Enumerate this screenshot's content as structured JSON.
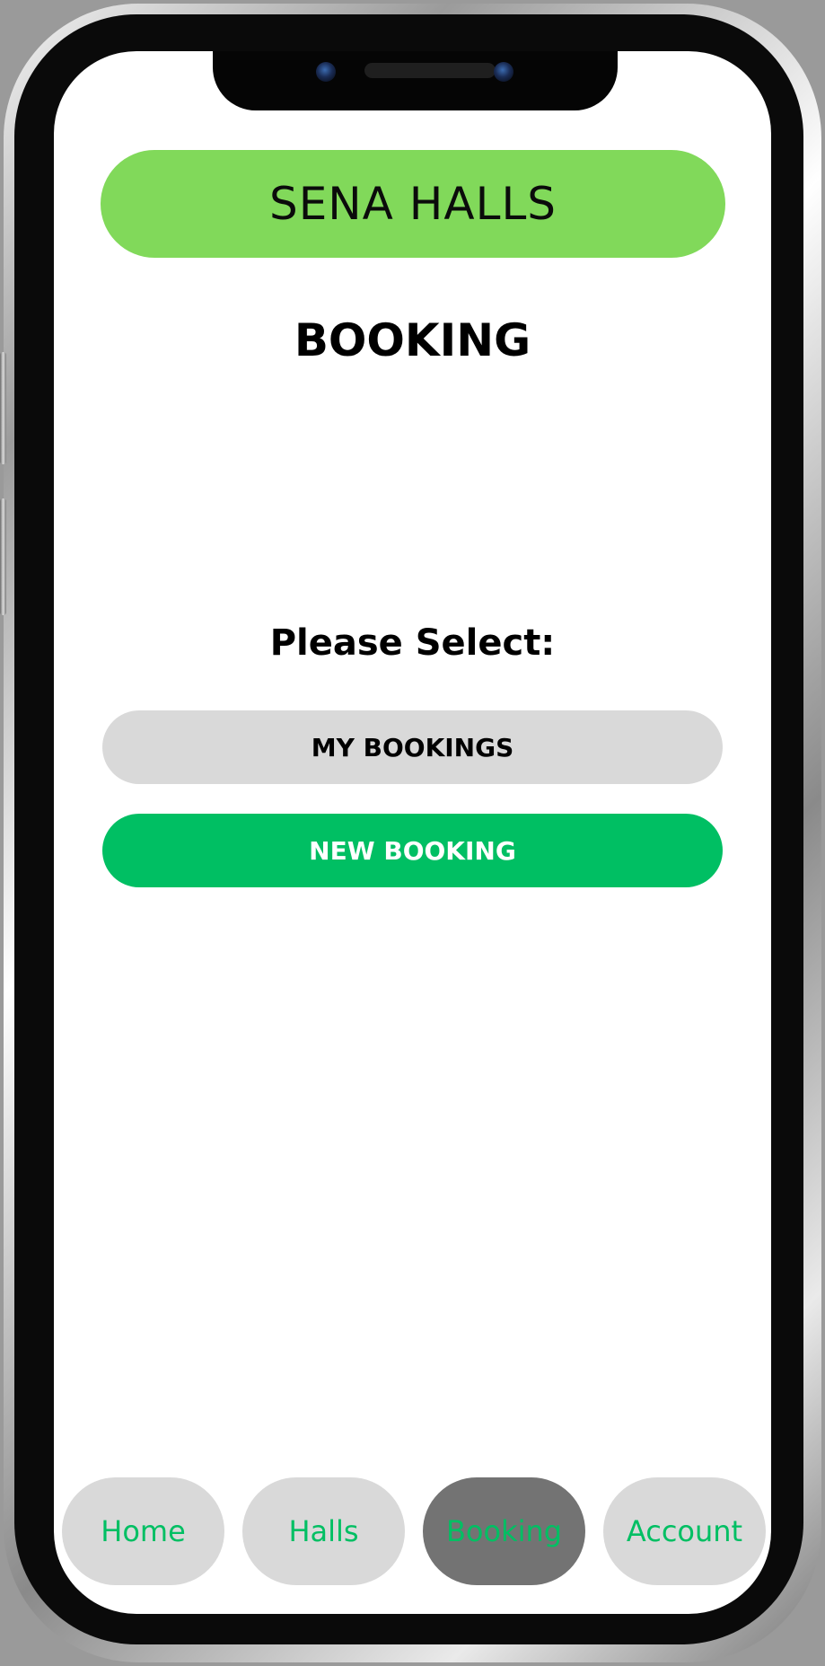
{
  "app": {
    "brand": "SENA HALLS",
    "page_title": "BOOKING"
  },
  "main": {
    "prompt": "Please Select:",
    "my_bookings_label": "MY BOOKINGS",
    "new_booking_label": "NEW BOOKING"
  },
  "nav": {
    "items": [
      {
        "label": "Home",
        "active": false
      },
      {
        "label": "Halls",
        "active": false
      },
      {
        "label": "Booking",
        "active": true
      },
      {
        "label": "Account",
        "active": false
      }
    ]
  },
  "colors": {
    "brand_green": "#81d95a",
    "accent_green": "#00bf63",
    "pill_gray": "#d9d9d9",
    "active_gray": "#737373"
  }
}
